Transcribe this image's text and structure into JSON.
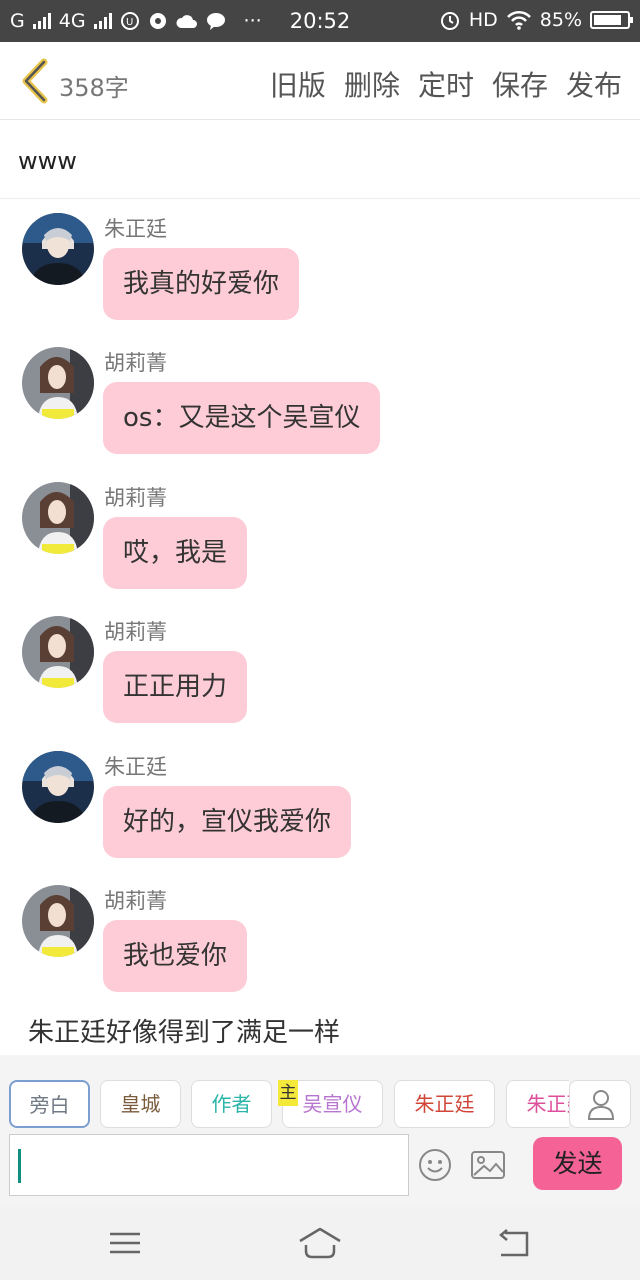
{
  "status_bar": {
    "carrier": "G",
    "network": "4G",
    "time": "20:52",
    "hd_label": "HD",
    "battery": "85%",
    "battery_level": 0.85
  },
  "toolbar": {
    "word_count": "358字",
    "actions": [
      "旧版",
      "删除",
      "定时",
      "保存",
      "发布"
    ]
  },
  "story_title": "www",
  "messages": [
    {
      "name": "朱正廷",
      "text": "我真的好爱你",
      "avatar": "male-avatar"
    },
    {
      "name": "胡莉菁",
      "text": "os：又是这个吴宣仪",
      "avatar": "female-avatar"
    },
    {
      "name": "胡莉菁",
      "text": "哎，我是",
      "avatar": "female-avatar"
    },
    {
      "name": "胡莉菁",
      "text": "正正用力",
      "avatar": "female-avatar"
    },
    {
      "name": "朱正廷",
      "text": "好的，宣仪我爱你",
      "avatar": "male-avatar"
    },
    {
      "name": "胡莉菁",
      "text": "我也爱你",
      "avatar": "female-avatar"
    }
  ],
  "narration": "朱正廷好像得到了满足一样",
  "roles": [
    {
      "label": "旁白",
      "color": "#6f7a86"
    },
    {
      "label": "皇城",
      "color": "#7a5b3c"
    },
    {
      "label": "作者",
      "color": "#2bb5a8"
    },
    {
      "label": "吴宣仪",
      "color": "#b774d0"
    },
    {
      "label": "朱正廷",
      "color": "#d0473a"
    },
    {
      "label": "朱正廷",
      "color": "#dd4f9b"
    }
  ],
  "master_tag": "主",
  "input": {
    "placeholder": ""
  },
  "send_label": "发送",
  "colors": {
    "bubble": "#fdccd7",
    "send": "#f56296",
    "status_bar": "#454545"
  }
}
